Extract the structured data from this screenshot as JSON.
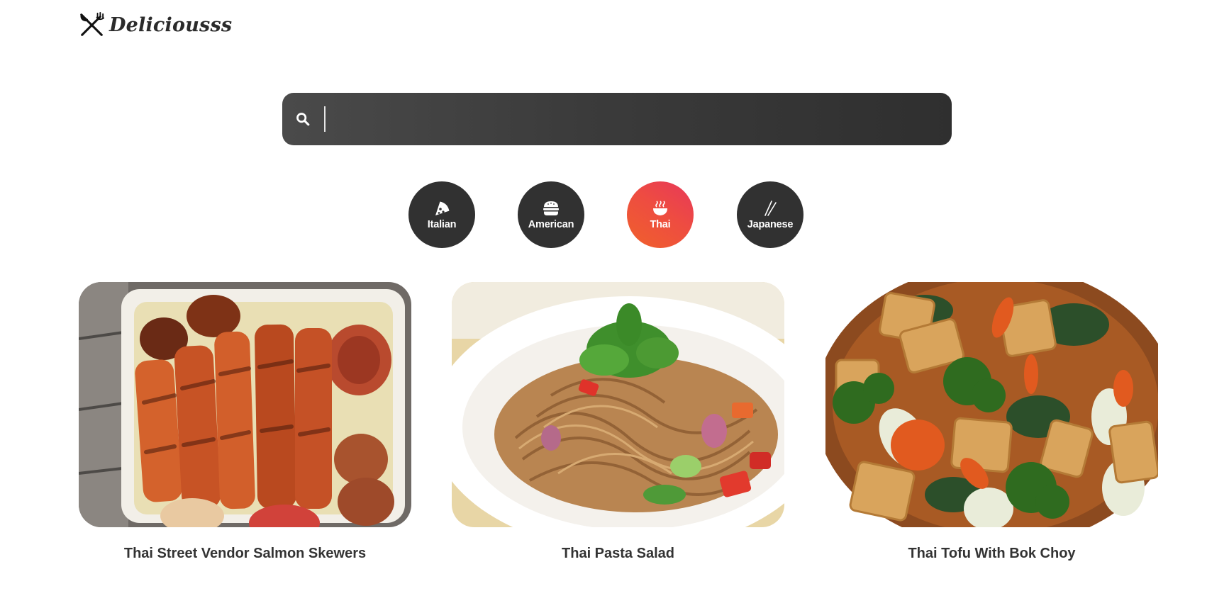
{
  "brand": {
    "name": "Deliciousss",
    "icon": "fork-knife-icon"
  },
  "search": {
    "placeholder": "",
    "value": "",
    "icon": "search-icon"
  },
  "categories": [
    {
      "label": "Italian",
      "icon": "pizza-icon",
      "active": false
    },
    {
      "label": "American",
      "icon": "burger-icon",
      "active": false
    },
    {
      "label": "Thai",
      "icon": "noodle-bowl-icon",
      "active": true
    },
    {
      "label": "Japanese",
      "icon": "chopsticks-icon",
      "active": false
    }
  ],
  "colors": {
    "dark": "#313131",
    "accent_start": "#f0612b",
    "accent_end": "#e7385a",
    "text": "#333333"
  },
  "recipes": [
    {
      "title": "Thai Street Vendor Salmon Skewers"
    },
    {
      "title": "Thai Pasta Salad"
    },
    {
      "title": "Thai Tofu With Bok Choy"
    }
  ]
}
